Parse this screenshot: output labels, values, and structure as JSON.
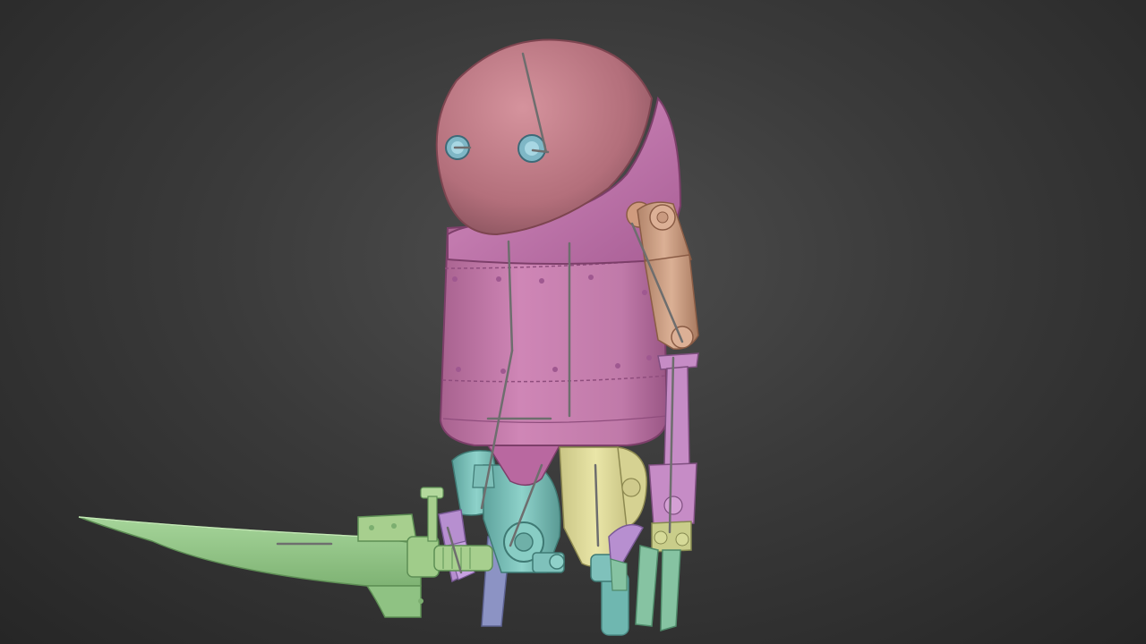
{
  "viewport": {
    "background_color": "#3a3a3a",
    "render_style": "viewport-shaded-clay-with-bones"
  },
  "model": {
    "parts": [
      {
        "name": "head",
        "color": "#c07a86"
      },
      {
        "name": "body-hood",
        "color": "#c173a8"
      },
      {
        "name": "body-barrel",
        "color": "#c57aac"
      },
      {
        "name": "eyes",
        "color": "#7fb7c6"
      },
      {
        "name": "right-arm-upper",
        "color": "#c89a7c"
      },
      {
        "name": "right-forearm",
        "color": "#c68cc6"
      },
      {
        "name": "right-hand",
        "color": "#c9cd8a"
      },
      {
        "name": "right-fingers",
        "color": "#86c3a2"
      },
      {
        "name": "left-leg",
        "color": "#e0dc9a"
      },
      {
        "name": "center-leg",
        "color": "#7fbfb8"
      },
      {
        "name": "left-hip-joint",
        "color": "#7fc1bb"
      },
      {
        "name": "pelvis-cone",
        "color": "#c57aac"
      },
      {
        "name": "shin",
        "color": "#8c93c4"
      },
      {
        "name": "sword-blade",
        "color": "#96c88a"
      },
      {
        "name": "sword-guard",
        "color": "#a7cf8e"
      },
      {
        "name": "left-hand",
        "color": "#b78fd0"
      },
      {
        "name": "bone",
        "color": "#6e6e6e"
      }
    ]
  }
}
